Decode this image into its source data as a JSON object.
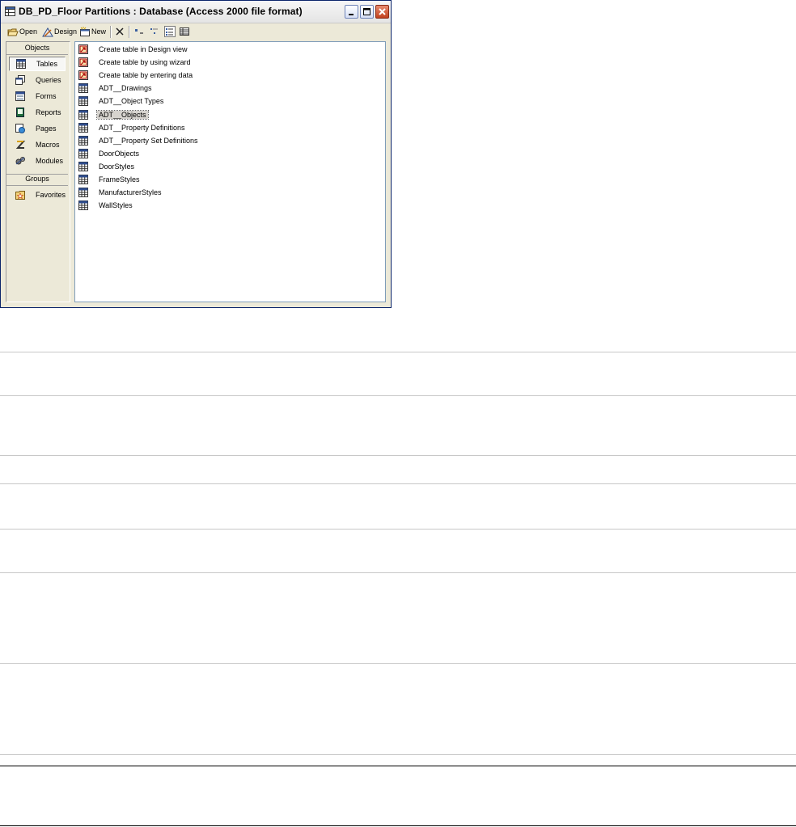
{
  "window": {
    "title": "DB_PD_Floor Partitions : Database (Access 2000 file format)"
  },
  "toolbar": {
    "open_label": "Open",
    "design_label": "Design",
    "new_label": "New",
    "icons": [
      "open-icon",
      "design-icon",
      "new-icon",
      "delete-icon",
      "large-icons-icon",
      "small-icons-icon",
      "list-view-icon",
      "details-view-icon"
    ]
  },
  "objects_bar": {
    "objects_header": "Objects",
    "groups_header": "Groups",
    "items": [
      {
        "label": "Tables",
        "icon": "table-icon",
        "selected": true
      },
      {
        "label": "Queries",
        "icon": "query-icon"
      },
      {
        "label": "Forms",
        "icon": "form-icon"
      },
      {
        "label": "Reports",
        "icon": "report-icon"
      },
      {
        "label": "Pages",
        "icon": "page-icon"
      },
      {
        "label": "Macros",
        "icon": "macro-icon"
      },
      {
        "label": "Modules",
        "icon": "module-icon"
      }
    ],
    "groups": [
      {
        "label": "Favorites",
        "icon": "favorites-folder-icon"
      }
    ]
  },
  "list": {
    "items": [
      {
        "label": "Create table in Design view",
        "icon": "shortcut-icon"
      },
      {
        "label": "Create table by using wizard",
        "icon": "shortcut-icon"
      },
      {
        "label": "Create table by entering data",
        "icon": "shortcut-icon"
      },
      {
        "label": "ADT__Drawings",
        "icon": "table-icon"
      },
      {
        "label": "ADT__Object Types",
        "icon": "table-icon"
      },
      {
        "label": "ADT__Objects",
        "icon": "table-icon",
        "selected": true
      },
      {
        "label": "ADT__Property Definitions",
        "icon": "table-icon"
      },
      {
        "label": "ADT__Property Set Definitions",
        "icon": "table-icon"
      },
      {
        "label": "DoorObjects",
        "icon": "table-icon"
      },
      {
        "label": "DoorStyles",
        "icon": "table-icon"
      },
      {
        "label": "FrameStyles",
        "icon": "table-icon"
      },
      {
        "label": "ManufacturerStyles",
        "icon": "table-icon"
      },
      {
        "label": "WallStyles",
        "icon": "table-icon"
      }
    ]
  },
  "colors": {
    "window_face": "#ece9d8",
    "list_background": "#ffffff",
    "close_button": "#c1421f",
    "selection": "#d6d3ce"
  }
}
